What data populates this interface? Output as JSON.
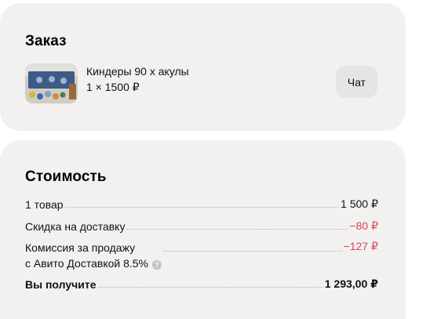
{
  "order": {
    "title": "Заказ",
    "item_title": "Киндеры 90 х акулы",
    "item_qty": "1 × 1500 ₽",
    "chat_label": "Чат"
  },
  "cost": {
    "title": "Стоимость",
    "rows": [
      {
        "label": "1 товар",
        "value": "1 500 ₽"
      },
      {
        "label": "Скидка на доставку",
        "value": "−80 ₽"
      },
      {
        "label_line1": "Комиссия за продажу",
        "label_line2": "с Авито Доставкой 8.5%",
        "value": "−127 ₽"
      }
    ],
    "total": {
      "label": "Вы получите",
      "value": "1 293,00 ₽"
    }
  },
  "colors": {
    "card_bg": "#f2f1f0",
    "negative": "#d9464f",
    "button_bg": "#e6e5e3"
  },
  "icons": {
    "help": "question-mark-circle"
  }
}
